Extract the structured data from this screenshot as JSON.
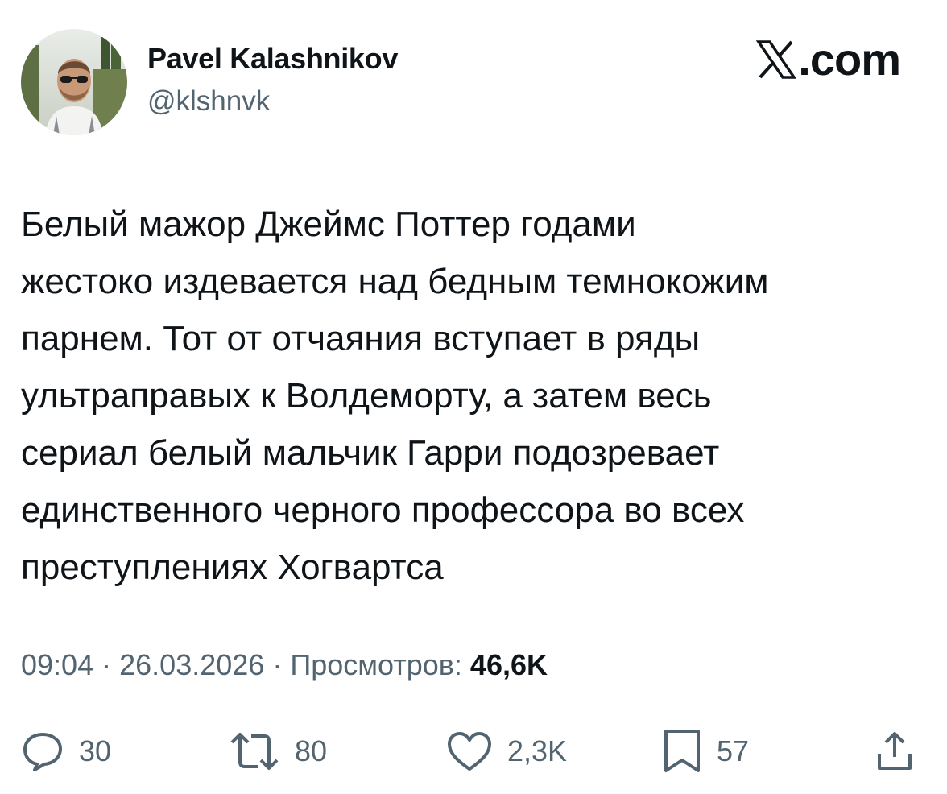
{
  "author": {
    "display_name": "Pavel Kalashnikov",
    "handle": "@klshnvk",
    "avatar_icon": "profile-photo"
  },
  "brand": {
    "label": ".com",
    "icon": "x-logo-icon"
  },
  "tweet": {
    "lines": [
      "Белый мажор Джеймс Поттер годами",
      "жестоко издевается над бедным темнокожим",
      "парнем. Тот от отчаяния вступает в ряды",
      "ультраправых к Волдеморту, а затем весь",
      "сериал белый мальчик Гарри подозревает",
      "единственного черного профессора во всех",
      "преступлениях Хогвартса"
    ]
  },
  "meta": {
    "time": "09:04",
    "separator": "·",
    "date": "26.03.2026",
    "views_label": "Просмотров:",
    "views_count": "46,6K"
  },
  "actions": {
    "reply": {
      "count": "30",
      "icon": "reply-icon"
    },
    "repost": {
      "count": "80",
      "icon": "repost-icon"
    },
    "like": {
      "count": "2,3K",
      "icon": "heart-icon"
    },
    "bookmark": {
      "count": "57",
      "icon": "bookmark-icon"
    },
    "share": {
      "icon": "share-icon"
    }
  },
  "colors": {
    "text": "#0f1419",
    "muted": "#536471",
    "background": "#ffffff"
  }
}
